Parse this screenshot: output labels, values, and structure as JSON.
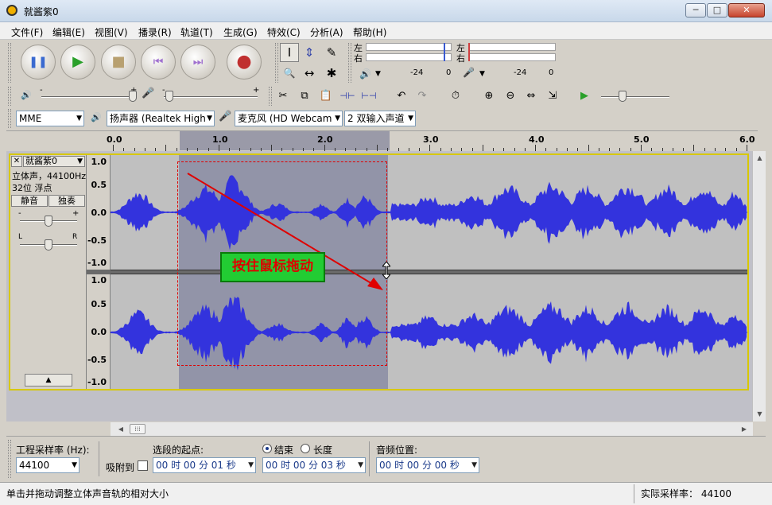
{
  "window": {
    "title": "就酱紫0",
    "min_glyph": "─",
    "max_glyph": "□",
    "close_glyph": "✕"
  },
  "menu": [
    "文件(F)",
    "编辑(E)",
    "视图(V)",
    "播录(R)",
    "轨道(T)",
    "生成(G)",
    "特效(C)",
    "分析(A)",
    "帮助(H)"
  ],
  "transport": {
    "pause_glyph": "❚❚",
    "play_glyph": "▶",
    "stop_glyph": "■",
    "skip_start_glyph": "⏮",
    "skip_end_glyph": "⏭",
    "record_glyph": "●"
  },
  "tools": {
    "selection_glyph": "I",
    "envelope_glyph": "⇕",
    "draw_glyph": "✎",
    "zoom_glyph": "🔍",
    "timeshift_glyph": "↔",
    "multi_glyph": "✱"
  },
  "meters": {
    "left": "左",
    "right": "右",
    "play_scale_a": "-24",
    "play_scale_b": "0",
    "rec_scale_a": "-24",
    "rec_scale_b": "0",
    "speaker_glyph": "🔊",
    "mic_glyph": "🎤",
    "dropdown_glyph": "▼"
  },
  "mixer": {
    "speaker_glyph": "🔊",
    "mic_glyph": "🎤",
    "minus": "-",
    "plus": "+"
  },
  "edit_tools": {
    "cut_glyph": "✂",
    "copy_glyph": "⧉",
    "paste_glyph": "📋",
    "trim_glyph": "⊣⊢",
    "silence_glyph": "⊢⊣",
    "undo_glyph": "↶",
    "redo_glyph": "↷",
    "sync_glyph": "⏱",
    "zoom_in_glyph": "⊕",
    "zoom_out_glyph": "⊖",
    "fit_sel_glyph": "⇔",
    "fit_proj_glyph": "⇲",
    "play_at_speed_glyph": "▶"
  },
  "devices": {
    "host": "MME",
    "output": "扬声器 (Realtek High",
    "input": "麦克风 (HD Webcam",
    "channels": "2 双输入声道",
    "arrow": "▼",
    "speaker_glyph": "🔊",
    "mic_glyph": "🎤"
  },
  "ruler": {
    "labels": [
      "0.0",
      "1.0",
      "2.0",
      "3.0",
      "4.0",
      "5.0",
      "6.0"
    ]
  },
  "track": {
    "close_glyph": "✕",
    "name": "就酱紫0",
    "menu_arrow": "▼",
    "info_line1": "立体声，44100Hz",
    "info_line2": "32位 浮点",
    "mute_label": "静音",
    "solo_label": "独奏",
    "gain_minus": "-",
    "gain_plus": "+",
    "pan_left": "L",
    "pan_right": "R",
    "collapse_glyph": "▲",
    "scale_top": [
      "1.0",
      "0.5",
      "0.0",
      "-0.5",
      "-1.0"
    ],
    "scale_bottom": [
      "1.0",
      "0.5",
      "0.0",
      "-0.5",
      "-1.0"
    ]
  },
  "annotation": {
    "text": "按住鼠标拖动"
  },
  "scroll": {
    "up": "▲",
    "down": "▼",
    "left": "◀",
    "right": "▶",
    "thumb": "⁞⁞⁞"
  },
  "selection": {
    "rate_label": "工程采样率 (Hz):",
    "rate_value": "44100",
    "snap_label": "吸附到",
    "start_label": "选段的起点:",
    "end_label": "结束",
    "length_label": "长度",
    "audio_pos_label": "音频位置:",
    "start_time": "00 时 00 分 01 秒",
    "end_time": "00 时 00 分 03 秒",
    "audio_pos": "00 时 00 分 00 秒",
    "arrow": "▼"
  },
  "status": {
    "message": "单击并拖动调整立体声音轨的相对大小",
    "actual_rate": "实际采样率： 44100"
  },
  "colors": {
    "waveform": "#3333dd",
    "selection": "#9294a8",
    "track_border": "#d8c800",
    "annotation_bg": "#22cc33",
    "annotation_text": "#e00000",
    "arrow": "#e00000"
  }
}
